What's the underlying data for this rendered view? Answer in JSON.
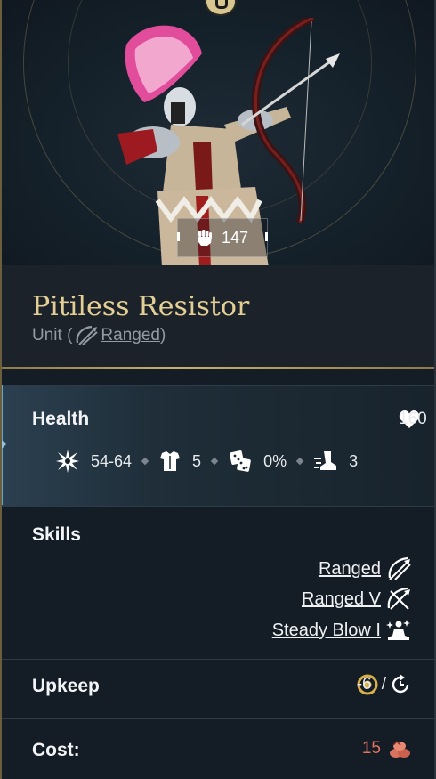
{
  "unit": {
    "name": "Pitiless Resistor",
    "subtitle_prefix": "Unit (",
    "subtitle_type": "Ranged",
    "subtitle_suffix": ")",
    "power": "147"
  },
  "health": {
    "label": "Health",
    "value": "160",
    "stats": [
      {
        "icon": "damage-burst-icon",
        "value": "54-64"
      },
      {
        "icon": "armor-icon",
        "value": "5"
      },
      {
        "icon": "dice-icon",
        "value": "0%"
      },
      {
        "icon": "movement-boot-icon",
        "value": "3"
      }
    ]
  },
  "skills": {
    "label": "Skills",
    "items": [
      {
        "name": "Ranged",
        "icon": "bow-arrows-icon"
      },
      {
        "name": "Ranged V",
        "icon": "bow-arrows-icon"
      },
      {
        "name": "Steady Blow I",
        "icon": "meditation-icon"
      }
    ]
  },
  "upkeep": {
    "label": "Upkeep",
    "value": "-6",
    "separator": "/",
    "icons": [
      "gold-coin-icon",
      "turn-cycle-icon"
    ]
  },
  "cost": {
    "label": "Cost:",
    "value": "15",
    "icon": "resource-pile-icon"
  },
  "colors": {
    "title_gold": "#e3cf95",
    "cost_red": "#e2735f",
    "gold_coin": "#d8b04a",
    "accent_blue": "#6aa6c4"
  }
}
